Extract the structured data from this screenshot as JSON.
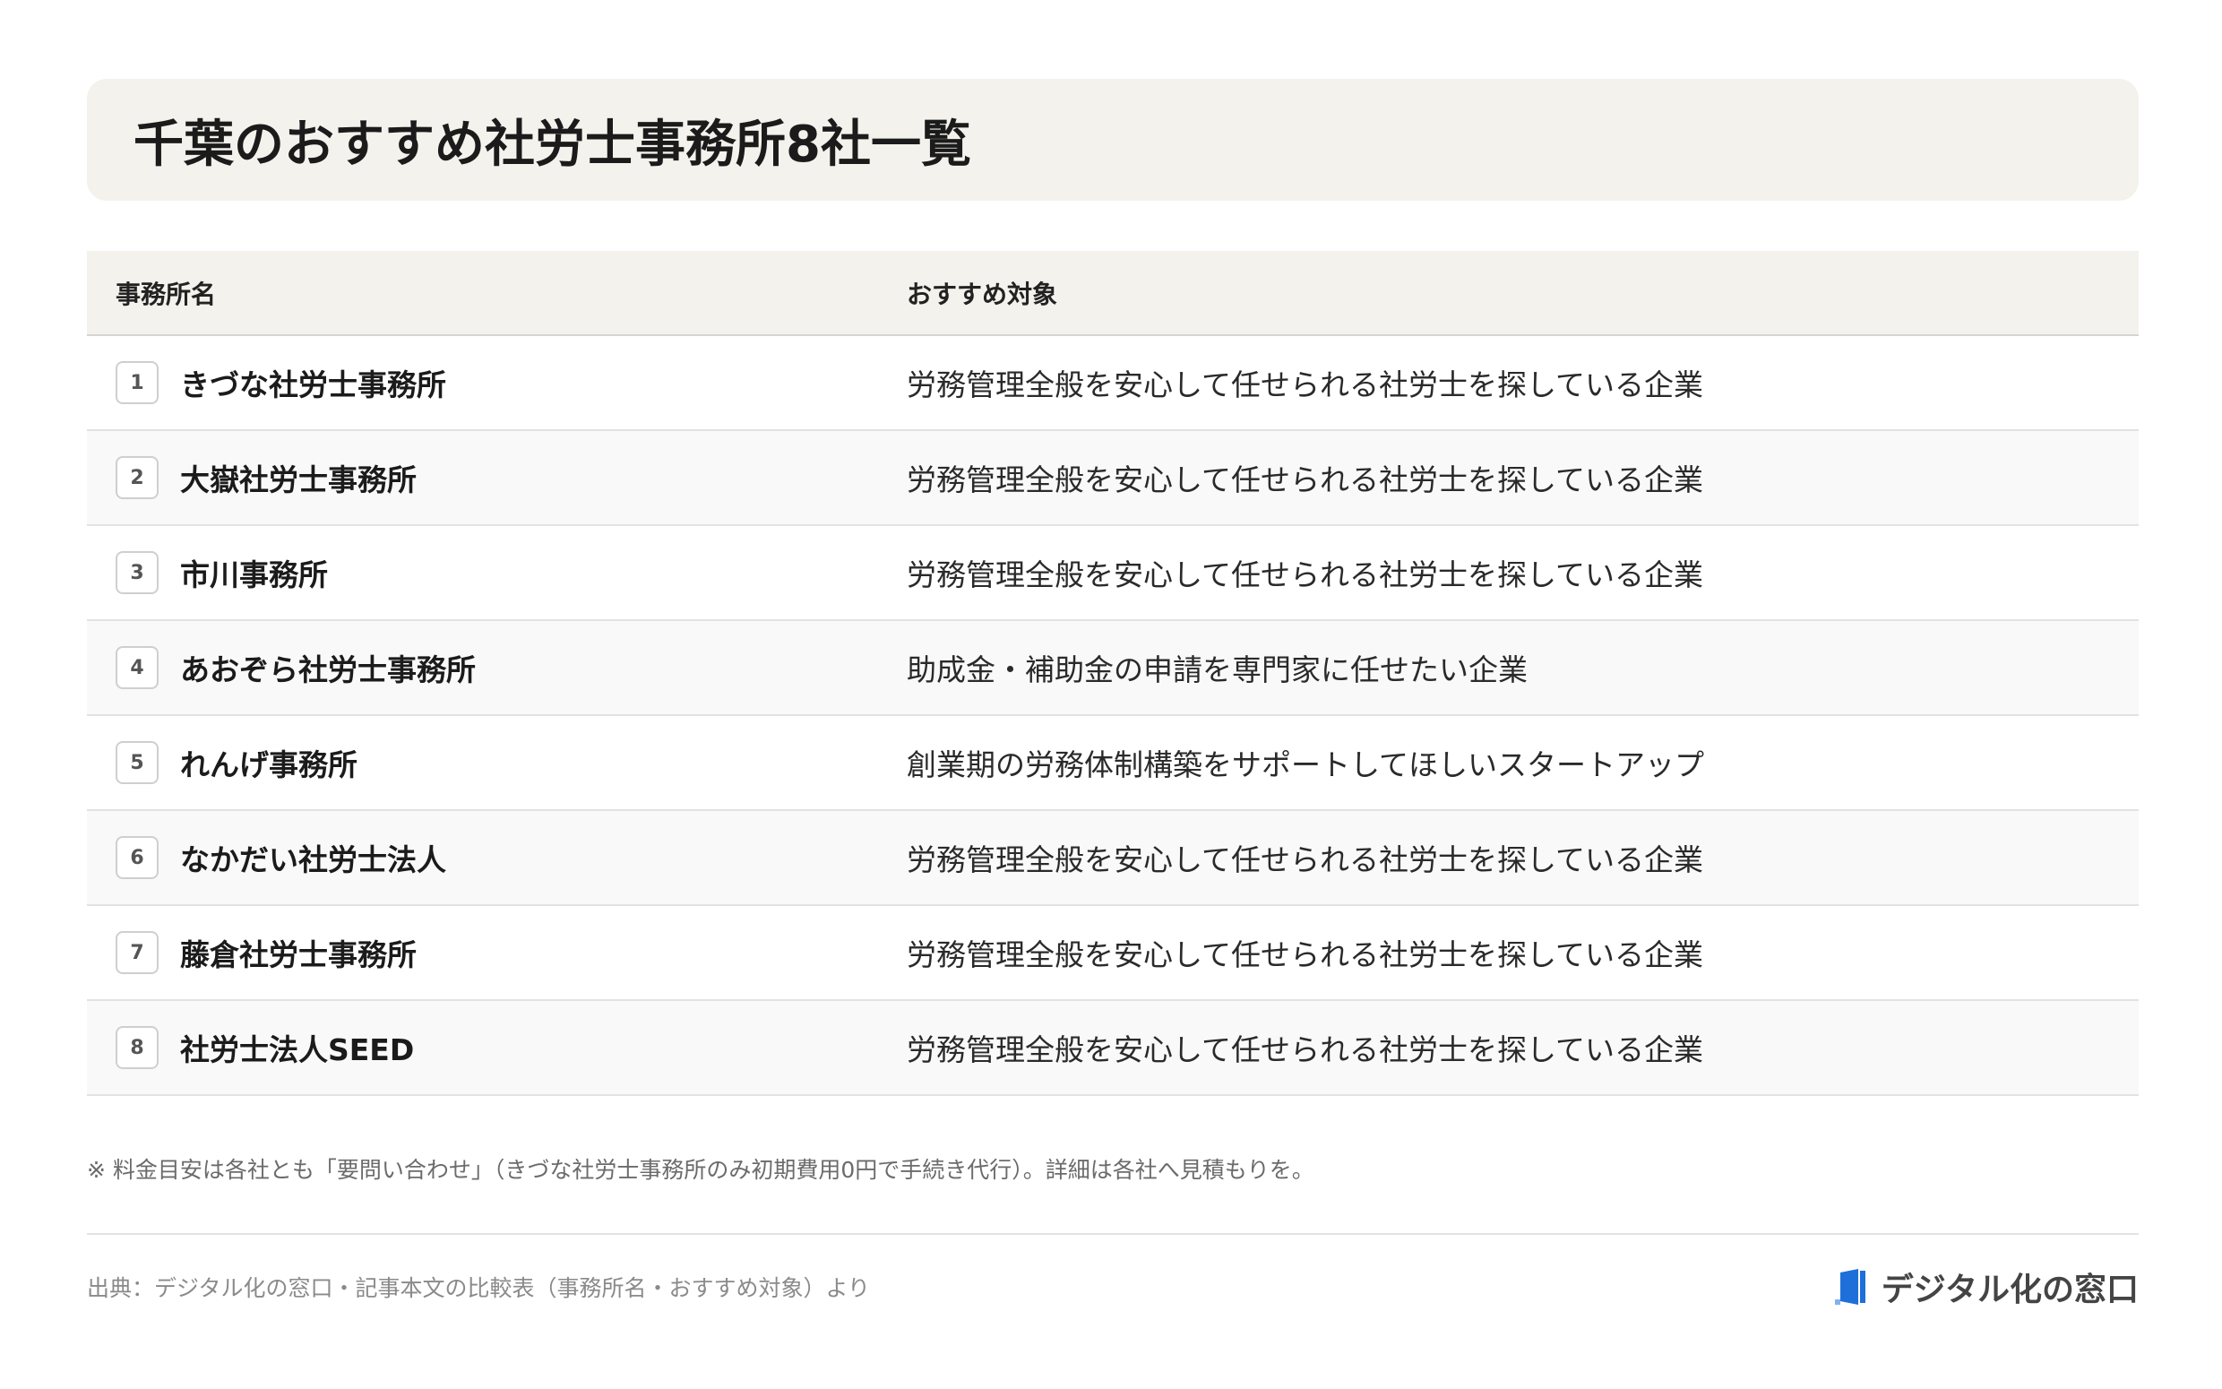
{
  "title": "千葉のおすすめ社労士事務所8社一覧",
  "table": {
    "headers": {
      "name": "事務所名",
      "target": "おすすめ対象"
    },
    "rows": [
      {
        "num": "1",
        "name": "きづな社労士事務所",
        "target": "労務管理全般を安心して任せられる社労士を探している企業"
      },
      {
        "num": "2",
        "name": "大嶽社労士事務所",
        "target": "労務管理全般を安心して任せられる社労士を探している企業"
      },
      {
        "num": "3",
        "name": "市川事務所",
        "target": "労務管理全般を安心して任せられる社労士を探している企業"
      },
      {
        "num": "4",
        "name": "あおぞら社労士事務所",
        "target": "助成金・補助金の申請を専門家に任せたい企業"
      },
      {
        "num": "5",
        "name": "れんげ事務所",
        "target": "創業期の労務体制構築をサポートしてほしいスタートアップ"
      },
      {
        "num": "6",
        "name": "なかだい社労士法人",
        "target": "労務管理全般を安心して任せられる社労士を探している企業"
      },
      {
        "num": "7",
        "name": "藤倉社労士事務所",
        "target": "労務管理全般を安心して任せられる社労士を探している企業"
      },
      {
        "num": "8",
        "name": "社労士法人SEED",
        "target": "労務管理全般を安心して任せられる社労士を探している企業"
      }
    ]
  },
  "note": "※ 料金目安は各社とも「要問い合わせ」（きづな社労士事務所のみ初期費用0円で手続き代行）。詳細は各社へ見積もりを。",
  "source": "出典：デジタル化の窓口・記事本文の比較表（事務所名・おすすめ対象）より",
  "brand": {
    "name": "デジタル化の窓口",
    "logo_icon": "door-logo-icon",
    "logo_color": "#1e6fd9"
  }
}
